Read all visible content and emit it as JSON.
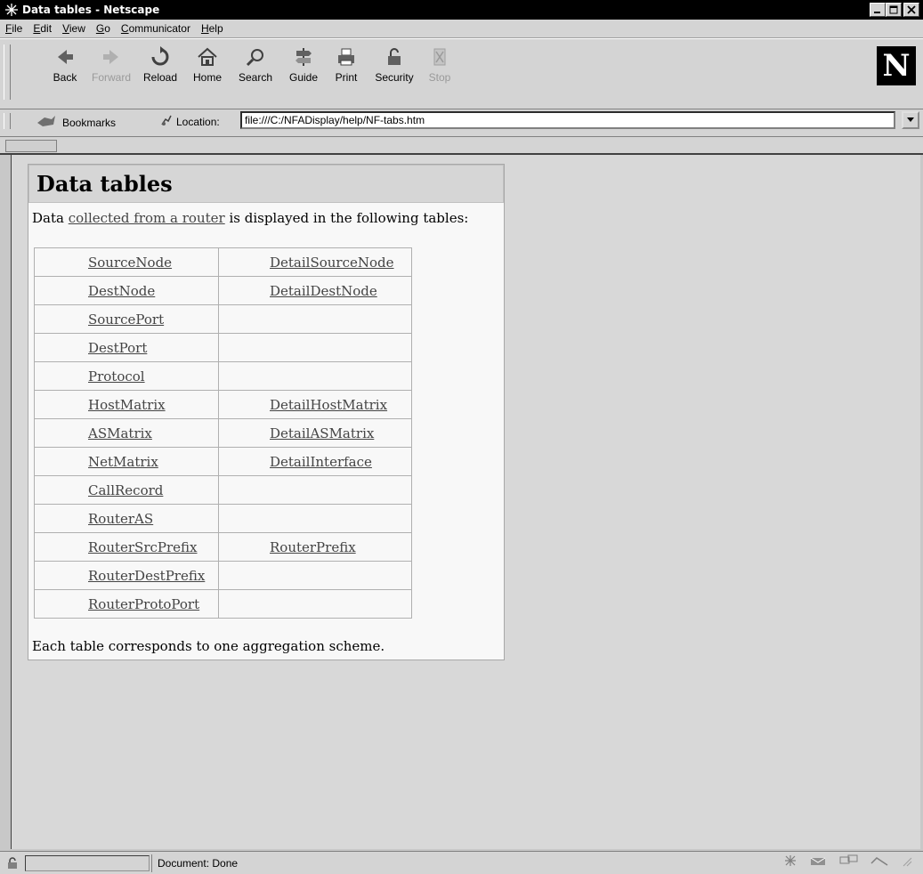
{
  "window": {
    "title": "Data tables - Netscape"
  },
  "menu": [
    {
      "key": "F",
      "rest": "ile"
    },
    {
      "key": "E",
      "rest": "dit"
    },
    {
      "key": "V",
      "rest": "iew"
    },
    {
      "key": "G",
      "rest": "o"
    },
    {
      "key": "C",
      "rest": "ommunicator"
    },
    {
      "key": "H",
      "rest": "elp"
    }
  ],
  "toolbar": {
    "back": "Back",
    "forward": "Forward",
    "reload": "Reload",
    "home": "Home",
    "search": "Search",
    "guide": "Guide",
    "print": "Print",
    "security": "Security",
    "stop": "Stop"
  },
  "logo": "N",
  "location": {
    "bookmarks_label": "Bookmarks",
    "location_label": "Location:",
    "url": "file:///C:/NFADisplay/help/NF-tabs.htm"
  },
  "page": {
    "heading": "Data tables",
    "intro_before": "Data ",
    "intro_link": "collected from a router",
    "intro_after": " is displayed in the following tables:",
    "table": [
      [
        "SourceNode",
        "DetailSourceNode"
      ],
      [
        "DestNode",
        "DetailDestNode"
      ],
      [
        "SourcePort",
        ""
      ],
      [
        "DestPort",
        ""
      ],
      [
        "Protocol",
        ""
      ],
      [
        "HostMatrix",
        "DetailHostMatrix"
      ],
      [
        "ASMatrix",
        "DetailASMatrix"
      ],
      [
        "NetMatrix",
        "DetailInterface"
      ],
      [
        "CallRecord",
        ""
      ],
      [
        "RouterAS",
        ""
      ],
      [
        "RouterSrcPrefix",
        "RouterPrefix"
      ],
      [
        "RouterDestPrefix",
        ""
      ],
      [
        "RouterProtoPort",
        ""
      ]
    ],
    "footer": "Each table corresponds to one aggregation scheme."
  },
  "status": {
    "text": "Document: Done"
  }
}
